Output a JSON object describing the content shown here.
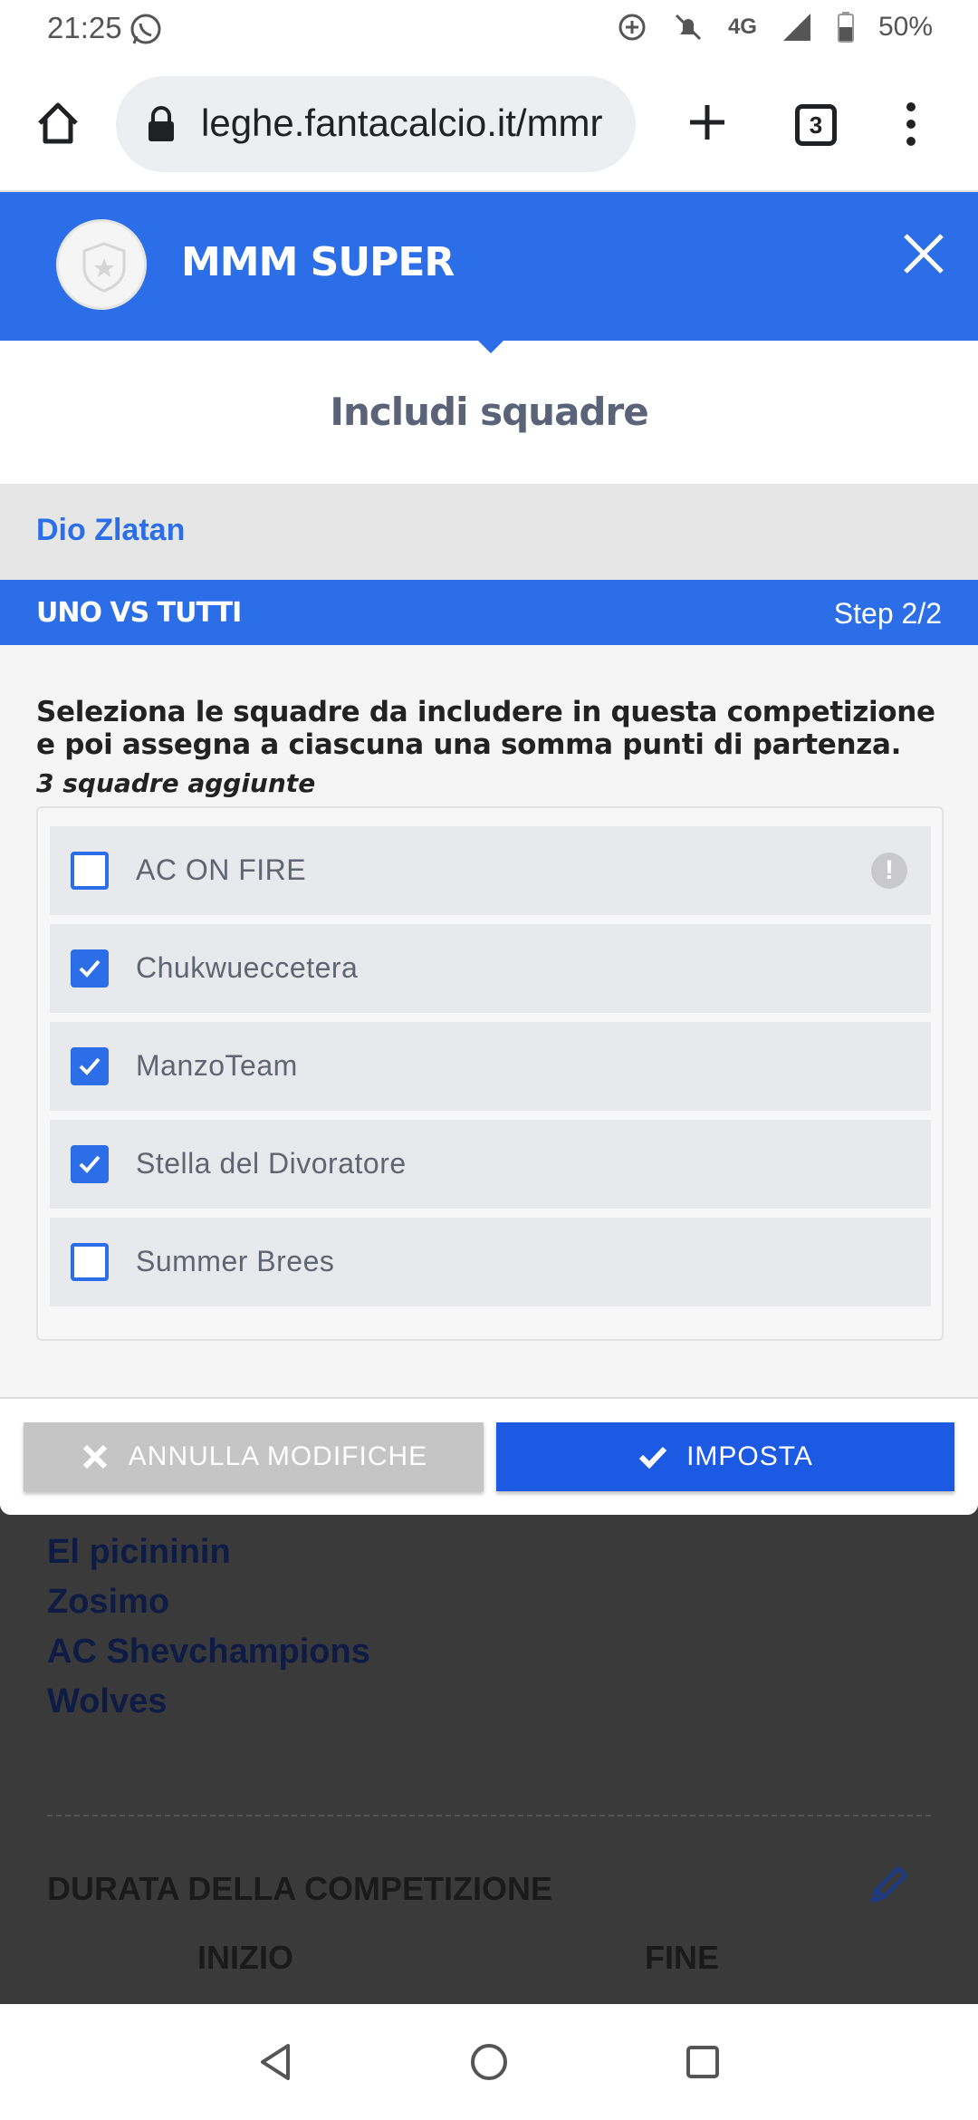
{
  "status_bar": {
    "time": "21:25",
    "network": "4G",
    "battery": "50%",
    "icons": [
      "whatsapp-icon",
      "data-saver-icon",
      "notifications-off-icon",
      "signal-icon",
      "battery-icon"
    ]
  },
  "browser": {
    "url": "leghe.fantacalcio.it/mmr",
    "tab_count": "3",
    "icons": [
      "home-icon",
      "lock-icon",
      "new-tab-icon",
      "tab-switcher-icon",
      "more-menu-icon"
    ]
  },
  "modal": {
    "league_name": "MMM SUPER",
    "title": "Includi squadre",
    "team": "Dio Zlatan",
    "competition": "UNO VS TUTTI",
    "step": "Step 2/2",
    "instructions": "Seleziona le squadre da includere in questa competizione e poi assegna a ciascuna una somma punti di partenza.",
    "count": "3 squadre aggiunte",
    "teams": [
      {
        "name": "AC ON FIRE",
        "checked": false,
        "warning": true
      },
      {
        "name": "Chukwueccetera",
        "checked": true,
        "warning": false
      },
      {
        "name": "ManzoTeam",
        "checked": true,
        "warning": false
      },
      {
        "name": "Stella del Divoratore",
        "checked": true,
        "warning": false
      },
      {
        "name": "Summer Brees",
        "checked": false,
        "warning": false
      }
    ],
    "cancel_label": "ANNULLA MODIFICHE",
    "confirm_label": "IMPOSTA"
  },
  "background_page": {
    "teams": [
      "El picininin",
      "Zosimo",
      "AC Shevchampions",
      "Wolves"
    ],
    "section_title": "DURATA DELLA COMPETIZIONE",
    "start_label": "INIZIO",
    "end_label": "FINE"
  },
  "colors": {
    "primary": "#2b6ee8",
    "button_blue": "#1d5ae4",
    "overlay": "#3a3a3a"
  }
}
